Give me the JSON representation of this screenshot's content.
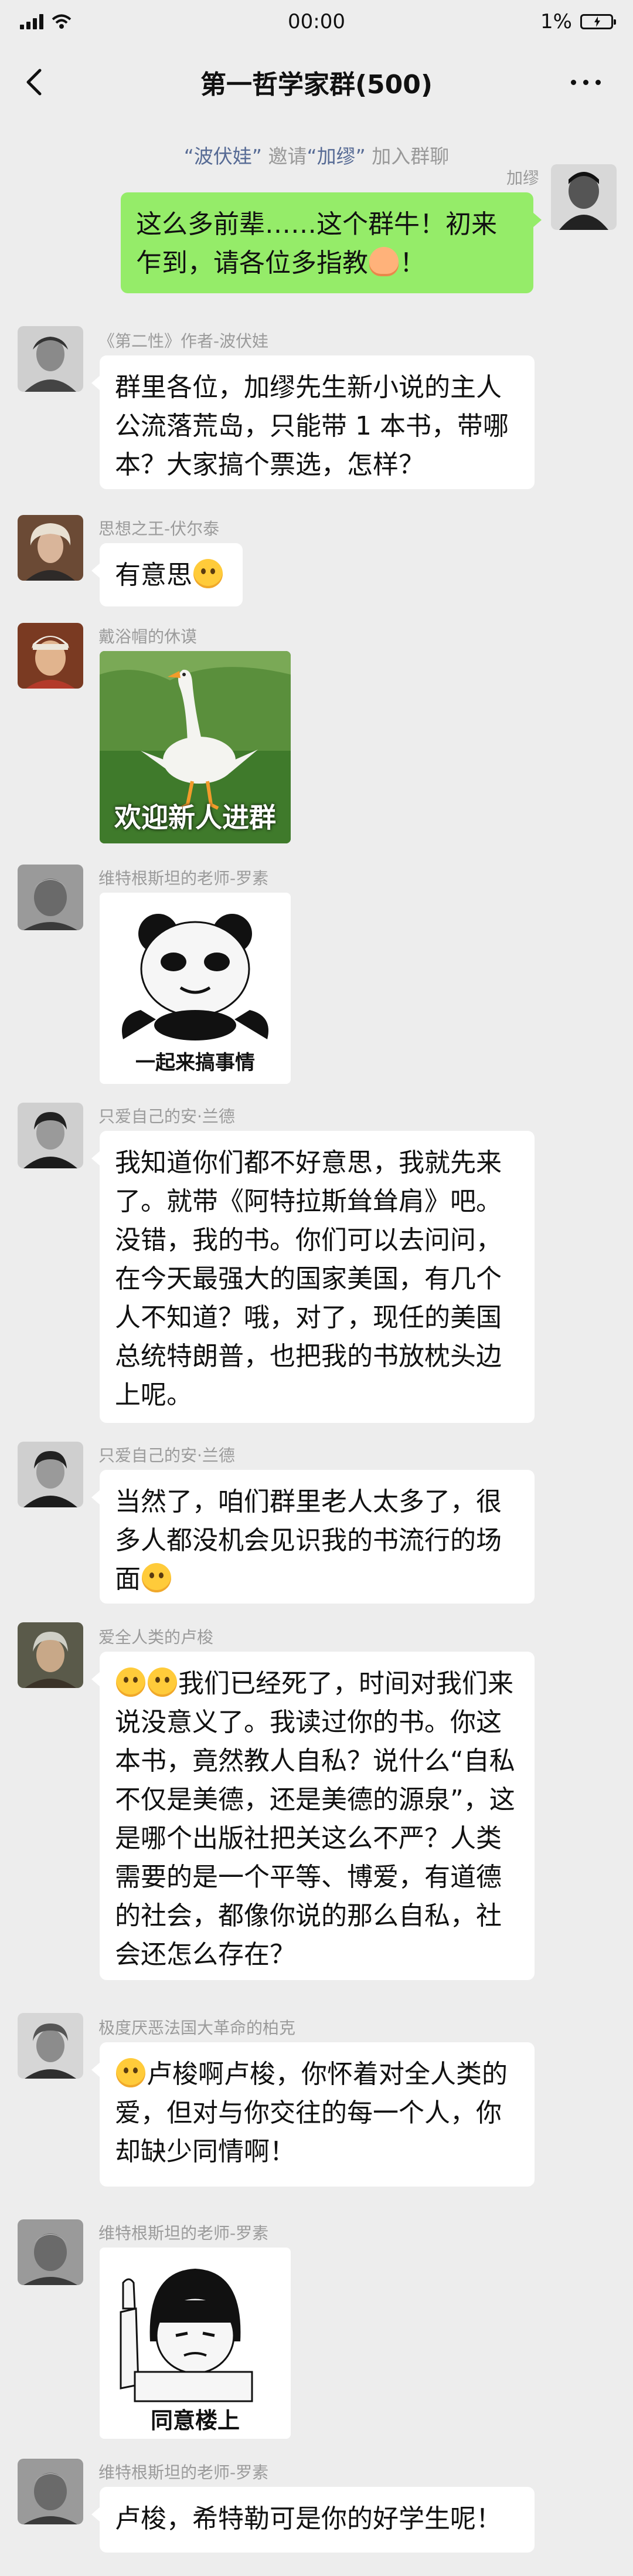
{
  "status_bar": {
    "time": "00:00",
    "battery": "1%"
  },
  "nav": {
    "title": "第一哲学家群(500)"
  },
  "system_message": {
    "inviter": "“波伏娃”",
    "verb": " 邀请",
    "invitee": "“加缪”",
    "suffix": " 加入群聊"
  },
  "messages": [
    {
      "sender": "加缪",
      "text_1": "这么多前辈……这个群牛！初来乍到，请各位多指教",
      "text_2": "！",
      "emoji": "pray-emoji"
    },
    {
      "sender": "《第二性》作者-波伏娃",
      "text": "群里各位，加缪先生新小说的主人公流落荒岛，只能带 1 本书，带哪本？大家搞个票选，怎样？"
    },
    {
      "sender": "思想之王-伏尔泰",
      "text": "有意思",
      "emoji": "grin-emoji"
    },
    {
      "sender": "戴浴帽的休谟",
      "sticker_caption": "欢迎新人进群"
    },
    {
      "sender": "维特根斯坦的老师-罗素",
      "sticker_caption": "一起来搞事情"
    },
    {
      "sender": "只爱自己的安·兰德",
      "text": "我知道你们都不好意思，我就先来了。就带《阿特拉斯耸耸肩》吧。没错，我的书。你们可以去问问，在今天最强大的国家美国，有几个人不知道？哦，对了，现任的美国总统特朗普，也把我的书放枕头边上呢。"
    },
    {
      "sender": "只爱自己的安·兰德",
      "text": "当然了，咱们群里老人太多了，很多人都没机会见识我的书流行的场面",
      "emoji": "grin-emoji"
    },
    {
      "sender": "爱全人类的卢梭",
      "text": "我们已经死了，时间对我们来说没意义了。我读过你的书。你这本书，竟然教人自私？说什么“自私不仅是美德，还是美德的源泉”，这是哪个出版社把关这么不严？人类需要的是一个平等、博爱，有道德的社会，都像你说的那么自私，社会还怎么存在？",
      "emoji": "facepalm-emoji"
    },
    {
      "sender": "极度厌恶法国大革命的柏克",
      "text": "卢梭啊卢梭，你怀着对全人类的爱，但对与你交往的每一个人，你却缺少同情啊！",
      "emoji": "facepalm-emoji"
    },
    {
      "sender": "维特根斯坦的老师-罗素",
      "sticker_caption": "同意楼上"
    },
    {
      "sender": "维特根斯坦的老师-罗素",
      "text": "卢梭，希特勒可是你的好学生呢！"
    }
  ]
}
